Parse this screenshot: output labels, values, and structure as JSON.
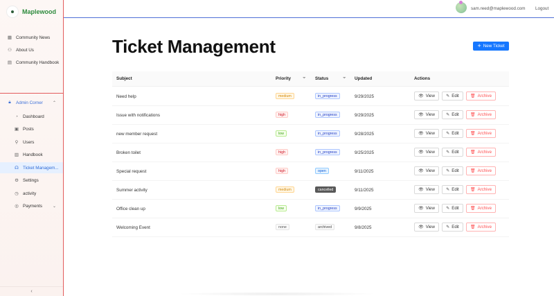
{
  "brand": {
    "name": "Maplewood"
  },
  "header": {
    "user_email": "sam.reed@maplewood.com",
    "logout_label": "Logout"
  },
  "sidebar": {
    "top_items": [
      {
        "label": "Community News",
        "icon": "grid-icon"
      },
      {
        "label": "About Us",
        "icon": "people-icon"
      },
      {
        "label": "Community Handbook",
        "icon": "book-icon"
      }
    ],
    "admin_group": {
      "label": "Admin Corner",
      "icon": "lock-icon"
    },
    "admin_items": [
      {
        "label": "Dashboard",
        "icon": "dashboard-icon"
      },
      {
        "label": "Posts",
        "icon": "posts-icon"
      },
      {
        "label": "Users",
        "icon": "user-icon"
      },
      {
        "label": "Handbook",
        "icon": "handbook-icon"
      },
      {
        "label": "Ticket Managem...",
        "icon": "headset-icon",
        "active": true
      },
      {
        "label": "Settings",
        "icon": "gear-icon"
      },
      {
        "label": "activity",
        "icon": "clock-icon"
      },
      {
        "label": "Payments",
        "icon": "payments-icon"
      }
    ],
    "collapse_glyph": "‹"
  },
  "main": {
    "title": "Ticket Management",
    "new_ticket_label": "New Ticket"
  },
  "table": {
    "headers": {
      "subject": "Subject",
      "priority": "Priority",
      "status": "Status",
      "updated": "Updated",
      "actions": "Actions"
    },
    "action_labels": {
      "view": "View",
      "edit": "Edit",
      "archive": "Archive"
    },
    "rows": [
      {
        "subject": "Need help",
        "priority": "medium",
        "status": "in_progress",
        "updated": "9/29/2025"
      },
      {
        "subject": "Issue with notifications",
        "priority": "high",
        "status": "in_progress",
        "updated": "9/29/2025"
      },
      {
        "subject": "new member request",
        "priority": "low",
        "status": "in_progress",
        "updated": "9/28/2025"
      },
      {
        "subject": "Broken toilet",
        "priority": "high",
        "status": "in_progress",
        "updated": "9/25/2025"
      },
      {
        "subject": "Special request",
        "priority": "high",
        "status": "open",
        "updated": "9/11/2025"
      },
      {
        "subject": "Summer activity",
        "priority": "medium",
        "status": "cancelled",
        "updated": "9/11/2025"
      },
      {
        "subject": "Office clean up",
        "priority": "low",
        "status": "in_progress",
        "updated": "9/9/2025"
      },
      {
        "subject": "Welcoming Event",
        "priority": "none",
        "status": "archived",
        "updated": "9/8/2025"
      }
    ]
  },
  "colors": {
    "accent": "#1677ff",
    "brand_green": "#2e8b3e",
    "priority": {
      "medium": {
        "bg": "#fff7e6",
        "border": "#ffd591",
        "fg": "#d48806"
      },
      "high": {
        "bg": "#fff1f0",
        "border": "#ffccc7",
        "fg": "#cf1322"
      },
      "low": {
        "bg": "#f6ffed",
        "border": "#b7eb8f",
        "fg": "#389e0d"
      },
      "none": {
        "bg": "#fafafa",
        "border": "#e5e5e5",
        "fg": "#555555"
      }
    },
    "status": {
      "in_progress": {
        "bg": "#f0f5ff",
        "border": "#adc6ff",
        "fg": "#1d39c4"
      },
      "open": {
        "bg": "#e6f4ff",
        "border": "#91caff",
        "fg": "#0958d9"
      },
      "cancelled": {
        "bg": "#595959",
        "border": "#595959",
        "fg": "#ffffff"
      },
      "archived": {
        "bg": "#fafafa",
        "border": "#e5e5e5",
        "fg": "#444444"
      }
    }
  }
}
